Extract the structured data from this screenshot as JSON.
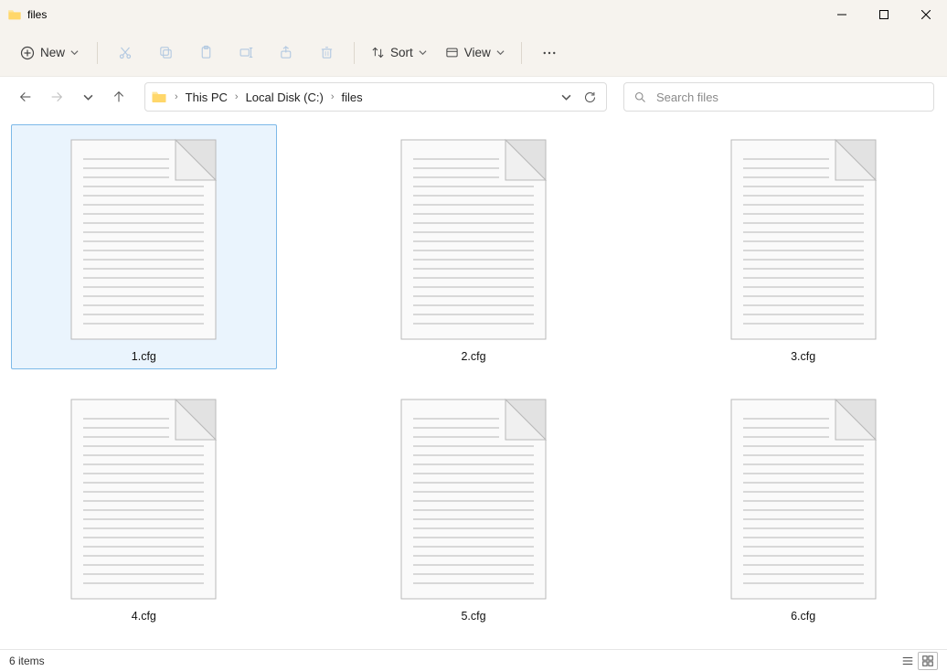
{
  "window": {
    "title": "files"
  },
  "toolbar": {
    "new_label": "New",
    "sort_label": "Sort",
    "view_label": "View"
  },
  "breadcrumbs": [
    "This PC",
    "Local Disk (C:)",
    "files"
  ],
  "search": {
    "placeholder": "Search files"
  },
  "files": [
    {
      "name": "1.cfg",
      "selected": true
    },
    {
      "name": "2.cfg",
      "selected": false
    },
    {
      "name": "3.cfg",
      "selected": false
    },
    {
      "name": "4.cfg",
      "selected": false
    },
    {
      "name": "5.cfg",
      "selected": false
    },
    {
      "name": "6.cfg",
      "selected": false
    }
  ],
  "status": {
    "count_label": "6 items"
  }
}
